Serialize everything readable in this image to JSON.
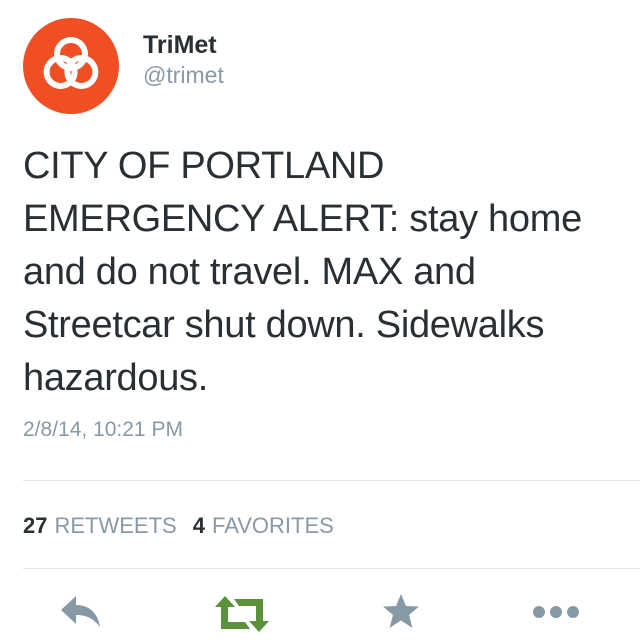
{
  "user": {
    "name": "TriMet",
    "handle": "@trimet"
  },
  "tweet": {
    "text": "CITY OF PORTLAND EMERGENCY ALERT: stay home and do not travel. MAX and Streetcar shut down. Sidewalks hazardous.",
    "timestamp": "2/8/14, 10:21 PM"
  },
  "stats": {
    "retweets_count": "27",
    "retweets_label": "RETWEETS",
    "favorites_count": "4",
    "favorites_label": "FAVORITES"
  },
  "actions": {
    "reply_icon": "reply-icon",
    "retweet_icon": "retweet-icon",
    "favorite_icon": "star-icon",
    "more_icon": "more-icon"
  },
  "colors": {
    "brand": "#f04e23",
    "retweet_active": "#5c913b",
    "muted": "#8899a6",
    "text": "#292f33"
  }
}
